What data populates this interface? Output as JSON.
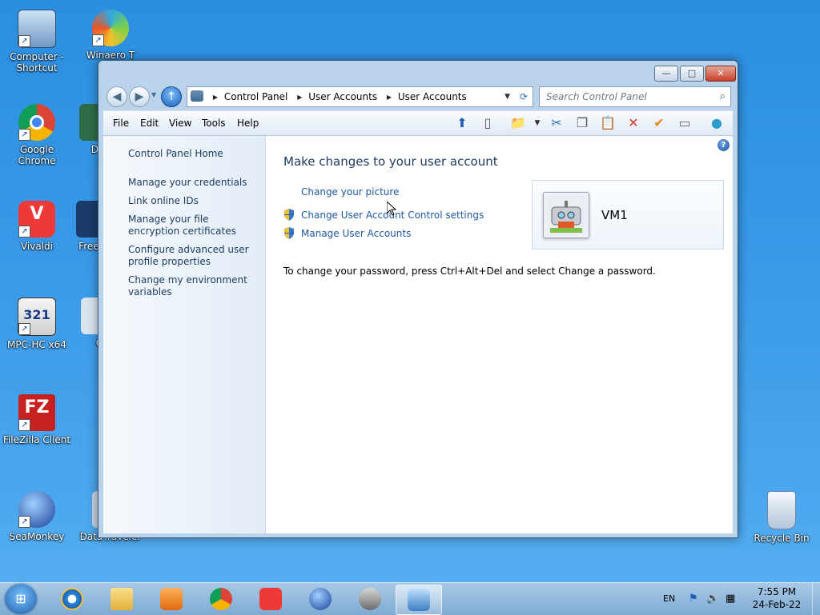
{
  "desktop": {
    "icons": [
      {
        "label": "Computer - Shortcut"
      },
      {
        "label": "Winaero T"
      },
      {
        "label": "Google Chrome"
      },
      {
        "label": "De"
      },
      {
        "label": "Vivaldi"
      },
      {
        "label": "Free M"
      },
      {
        "label": "MPC-HC x64"
      },
      {
        "label": "C"
      },
      {
        "label": "FileZilla Client"
      },
      {
        "label": "SeaMonkey"
      },
      {
        "label": "DataTraveler"
      },
      {
        "label": "Recycle Bin"
      }
    ]
  },
  "window": {
    "controls": {
      "minimize": "—",
      "maximize": "□",
      "close": "✕"
    },
    "nav": {
      "back": "◀",
      "forward": "▶",
      "up": "↑"
    },
    "breadcrumb": [
      "Control Panel",
      "User Accounts",
      "User Accounts"
    ],
    "search_placeholder": "Search Control Panel",
    "menu": [
      "File",
      "Edit",
      "View",
      "Tools",
      "Help"
    ],
    "sidebar": {
      "home": "Control Panel Home",
      "links": [
        "Manage your credentials",
        "Link online IDs",
        "Manage your file encryption certificates",
        "Configure advanced user profile properties",
        "Change my environment variables"
      ]
    },
    "main": {
      "title": "Make changes to your user account",
      "tasks": [
        {
          "label": "Change your picture",
          "shield": false
        },
        {
          "label": "Change User Account Control settings",
          "shield": true
        },
        {
          "label": "Manage User Accounts",
          "shield": true
        }
      ],
      "account_name": "VM1",
      "password_note": "To change your password, press Ctrl+Alt+Del and select Change a password."
    }
  },
  "taskbar": {
    "language": "EN",
    "time": "7:55 PM",
    "date": "24-Feb-22"
  },
  "colors": {
    "link": "#1e5aa0",
    "heading": "#1e3a5f",
    "desktop": "#3a9ae8"
  }
}
